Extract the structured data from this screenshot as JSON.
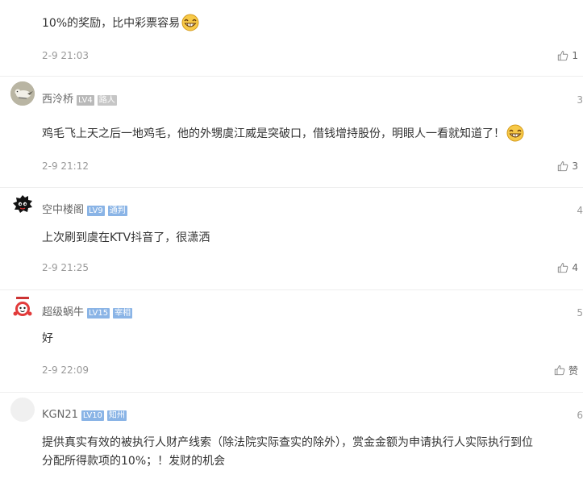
{
  "comments": [
    {
      "text": "10%的奖励，比中彩票容易",
      "emoji": "grinning-emoji",
      "time": "2-9 21:03",
      "likes": "1"
    },
    {
      "author": "西泠桥",
      "level": "LV4",
      "tag": "路人",
      "floor": "3",
      "avatar": "bird-avatar",
      "text": "鸡毛飞上天之后一地鸡毛，他的外甥虞江威是突破口，借钱增持股份，明眼人一看就知道了！",
      "emoji": "grinning-emoji",
      "time": "2-9 21:12",
      "likes": "3"
    },
    {
      "author": "空中楼阁",
      "level": "LV9",
      "tag": "通判",
      "floor": "4",
      "avatar": "black-creature-avatar",
      "text": "上次刷到虞在KTV抖音了，很潇洒",
      "time": "2-9 21:25",
      "likes": "4"
    },
    {
      "author": "超级蜗牛",
      "level": "LV15",
      "tag": "宰相",
      "floor": "5",
      "avatar": "red-white-avatar",
      "text": "好",
      "time": "2-9 22:09",
      "likes": "赞"
    },
    {
      "author": "KGN21",
      "level": "LV10",
      "tag": "知州",
      "floor": "6",
      "avatar": "blank-avatar",
      "text_line1": "提供真实有效的被执行人财产线索（除法院实际查实的除外），赏金金额为申请执行人实际执行到位",
      "text_line2": "分配所得款项的10%；！发财的机会"
    }
  ],
  "colors": {
    "level_gray": "#b9b9b9",
    "level_blue": "#8ab4e6",
    "separator": "#eeeeee",
    "meta_text": "#999999"
  },
  "icons": [
    "thumbs-up-icon",
    "grinning-emoji"
  ]
}
